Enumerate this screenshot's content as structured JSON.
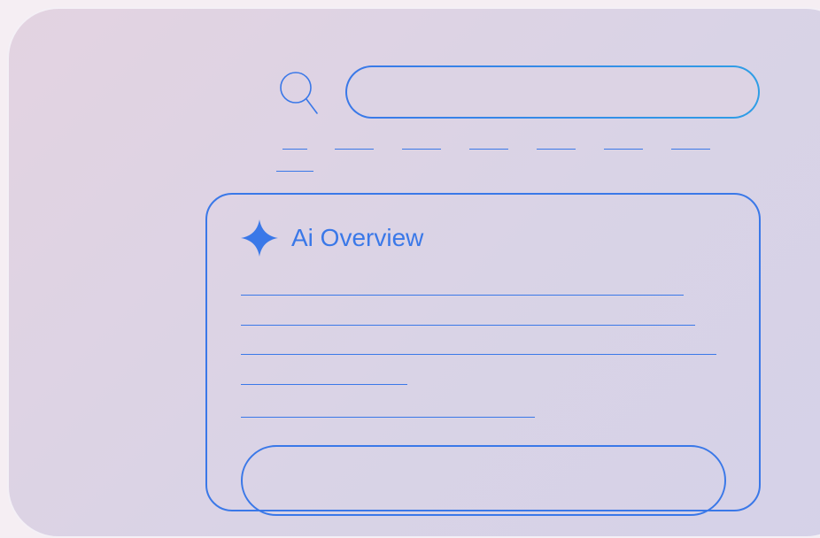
{
  "ai_overview": {
    "title": "Ai Overview"
  },
  "colors": {
    "accent": "#3a78e8",
    "accent_gradient_end": "#2f9ee6",
    "background_start": "#e3d3e1",
    "background_end": "#d5d2e8",
    "frame_border": "#f4f0f6"
  },
  "icons": {
    "search": "search-icon",
    "sparkle": "sparkle-icon"
  }
}
